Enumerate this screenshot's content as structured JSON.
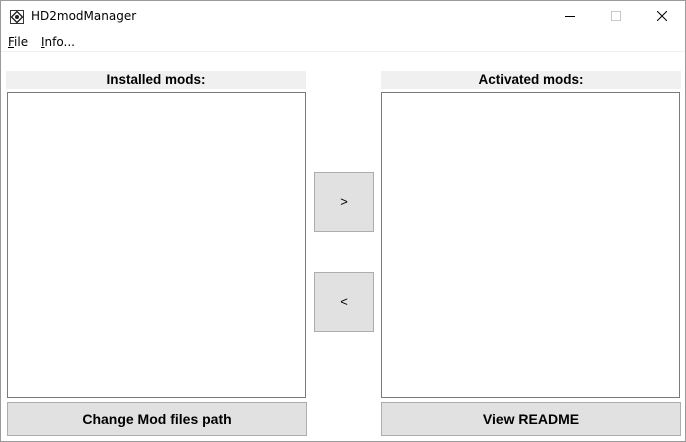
{
  "window": {
    "title": "HD2modManager"
  },
  "menu": {
    "file_accel": "F",
    "file_rest": "ile",
    "info_accel": "I",
    "info_rest": "nfo..."
  },
  "installed": {
    "header": "Installed mods:",
    "items": []
  },
  "activated": {
    "header": "Activated mods:",
    "items": []
  },
  "buttons": {
    "activate_label": ">",
    "deactivate_label": "<",
    "change_path_label": "Change Mod files path",
    "readme_label": "View README"
  },
  "icons": {
    "app": "hd2-app-icon",
    "minimize": "minimize-icon",
    "maximize": "maximize-icon",
    "close": "close-icon"
  }
}
